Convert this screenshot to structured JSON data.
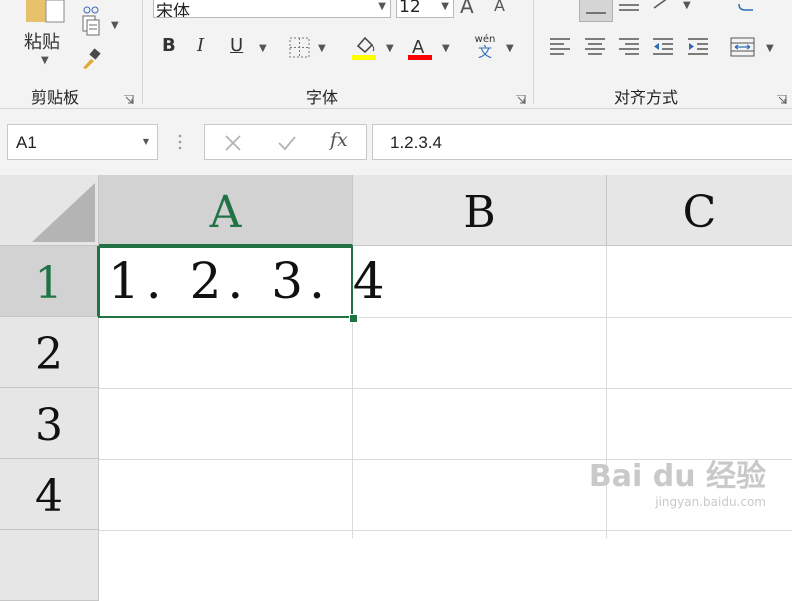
{
  "ribbon": {
    "clipboard": {
      "paste_label": "粘贴",
      "group_label": "剪贴板"
    },
    "font": {
      "font_name": "宋体",
      "font_size": "12",
      "bold": "B",
      "italic": "I",
      "underline": "U",
      "phonetic_top": "wén",
      "phonetic_bottom": "文",
      "group_label": "字体",
      "fill_color": "#ffff00",
      "font_color": "#ff0000"
    },
    "alignment": {
      "group_label": "对齐方式"
    }
  },
  "formula_bar": {
    "name_box": "A1",
    "fx_label": "fx",
    "content": "1.2.3.4"
  },
  "sheet": {
    "columns": [
      "A",
      "B",
      "C"
    ],
    "rows": [
      "1",
      "2",
      "3",
      "4"
    ],
    "cells": {
      "A1": "1. 2. 3. 4"
    },
    "active_cell": "A1",
    "accent_color": "#217346"
  },
  "watermark": {
    "brand": "Bai du 经验",
    "url": "jingyan.baidu.com"
  }
}
